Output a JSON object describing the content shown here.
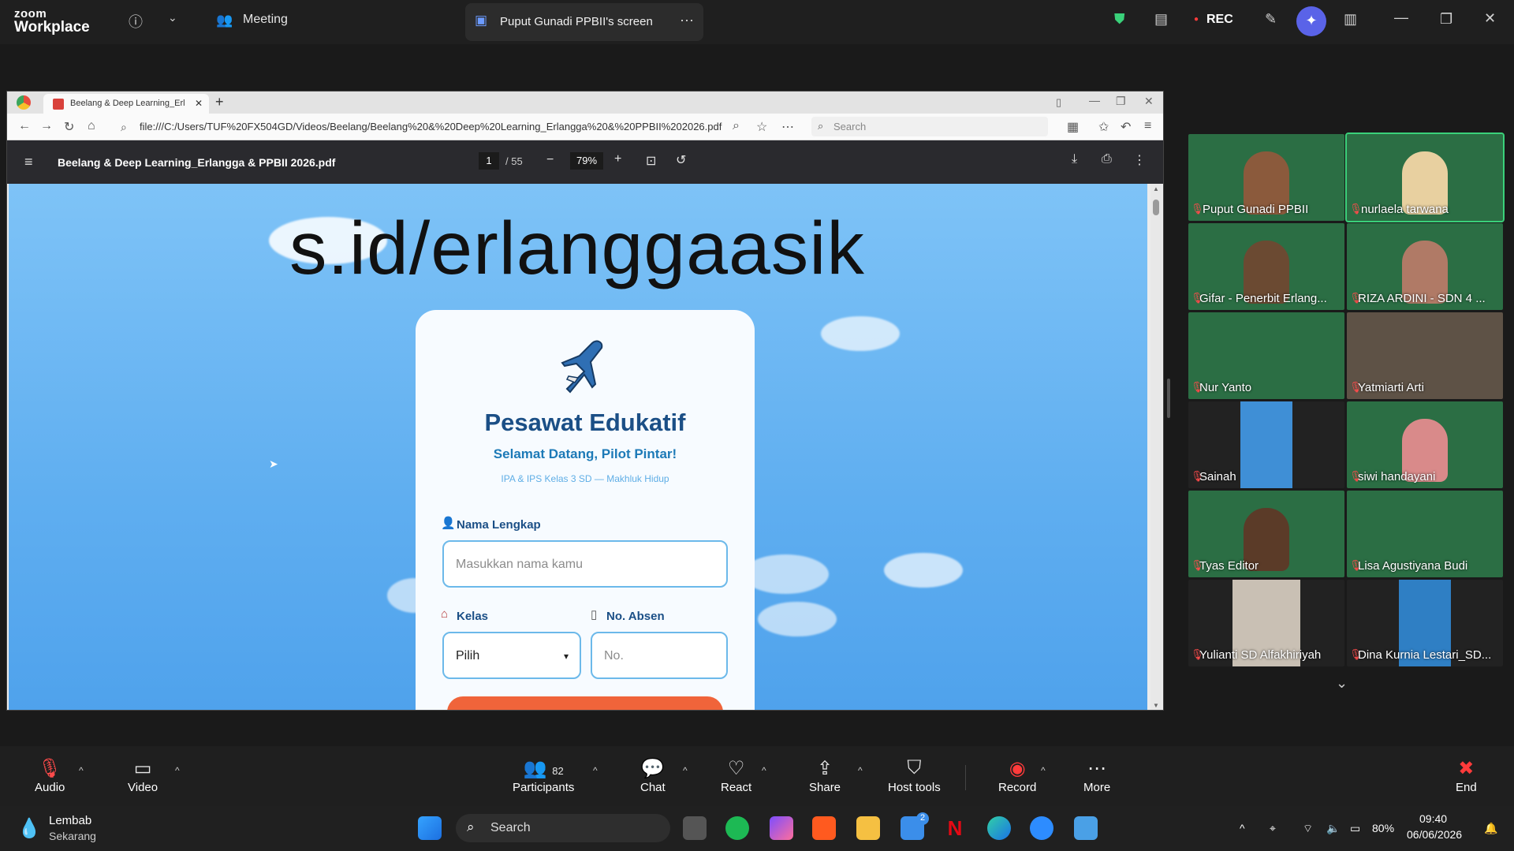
{
  "zoom_top": {
    "logo_line1": "zoom",
    "logo_line2": "Workplace",
    "meeting_label": "Meeting",
    "screen_share_label": "Puput Gunadi PPBII's screen",
    "rec_label": "REC"
  },
  "browser": {
    "tab_title": "Beelang & Deep Learning_Erl",
    "url": "file:///C:/Users/TUF%20FX504GD/Videos/Beelang/Beelang%20&%20Deep%20Learning_Erlangga%20&%20PPBII%202026.pdf",
    "search_placeholder": "Search"
  },
  "pdf": {
    "title": "Beelang & Deep Learning_Erlangga & PPBII 2026.pdf",
    "current_page": "1",
    "total_pages": "/ 55",
    "zoom": "79%",
    "headline": "s.id/erlanggaasik",
    "card": {
      "title": "Pesawat Edukatif",
      "subtitle": "Selamat Datang, Pilot Pintar!",
      "subtitle2": "IPA & IPS Kelas 3 SD — Makhluk Hidup",
      "name_label": "Nama Lengkap",
      "name_placeholder": "Masukkan nama kamu",
      "class_label": "Kelas",
      "class_value": "Pilih",
      "absen_label": "No. Absen",
      "absen_placeholder": "No."
    }
  },
  "participants": [
    {
      "name": "Puput Gunadi PPBII"
    },
    {
      "name": "nurlaela tarwana"
    },
    {
      "name": "Gifar - Penerbit Erlang..."
    },
    {
      "name": "RIZA ARDINI - SDN 4 ..."
    },
    {
      "name": "Nur Yanto"
    },
    {
      "name": "Yatmiarti Arti"
    },
    {
      "name": "Sainah"
    },
    {
      "name": "siwi handayani"
    },
    {
      "name": "Tyas Editor"
    },
    {
      "name": "Lisa Agustiyana Budi"
    },
    {
      "name": "Yulianti SD Alfakhiriyah"
    },
    {
      "name": "Dina Kurnia Lestari_SD..."
    }
  ],
  "toolbar": {
    "audio": "Audio",
    "video": "Video",
    "participants": "Participants",
    "participants_count": "82",
    "chat": "Chat",
    "react": "React",
    "share": "Share",
    "host_tools": "Host tools",
    "record": "Record",
    "more": "More",
    "end": "End"
  },
  "taskbar": {
    "weather_line1": "Lembab",
    "weather_line2": "Sekarang",
    "search": "Search",
    "notif_badge": "2",
    "battery": "80%",
    "time": "09:40",
    "date": "06/06/2026"
  },
  "colors": {
    "zoom_bg": "#1f1f1f",
    "active_speaker": "#3ad17a",
    "record_red": "#ff3b3b",
    "card_title": "#1b4f86"
  }
}
